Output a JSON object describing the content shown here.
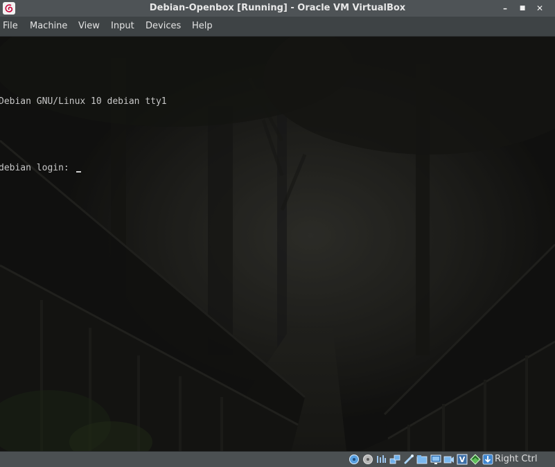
{
  "window": {
    "title": "Debian-Openbox [Running] - Oracle VM VirtualBox",
    "controls": {
      "minimize": "–",
      "maximize": "■",
      "close": "✕"
    }
  },
  "menubar": {
    "items": [
      "File",
      "Machine",
      "View",
      "Input",
      "Devices",
      "Help"
    ]
  },
  "console": {
    "lines": [
      "Debian GNU/Linux 10 debian tty1",
      "debian login: "
    ]
  },
  "statusbar": {
    "icons": [
      "hard-disk-icon",
      "optical-drive-icon",
      "audio-icon",
      "network-icon",
      "usb-icon",
      "shared-folders-icon",
      "display-icon",
      "video-capture-icon",
      "vt-x-icon",
      "guest-additions-icon",
      "mouse-integration-icon"
    ],
    "host_key": "Right Ctrl"
  },
  "colors": {
    "titlebar": "#4e5356",
    "menubar": "#3e4345",
    "statusbar": "#4b5052",
    "console_text": "#c8c8c8"
  }
}
